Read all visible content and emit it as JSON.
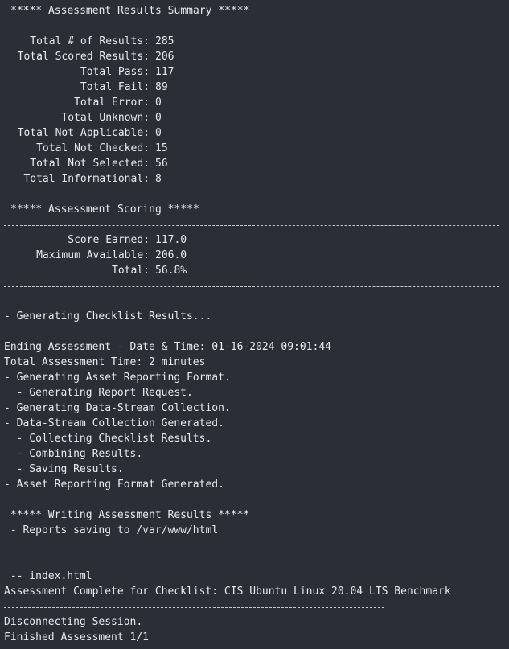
{
  "header": {
    "title": "***** Assessment Results Summary *****"
  },
  "results": [
    {
      "key": "Total # of Results:",
      "value": "285"
    },
    {
      "key": "Total Scored Results:",
      "value": "206"
    },
    {
      "key": "Total Pass:",
      "value": "117"
    },
    {
      "key": "Total Fail:",
      "value": "89"
    },
    {
      "key": "Total Error:",
      "value": "0"
    },
    {
      "key": "Total Unknown:",
      "value": "0"
    },
    {
      "key": "Total Not Applicable:",
      "value": "0"
    },
    {
      "key": "Total Not Checked:",
      "value": "15"
    },
    {
      "key": "Total Not Selected:",
      "value": "56"
    },
    {
      "key": "Total Informational:",
      "value": "8"
    }
  ],
  "scoring": {
    "title": "***** Assessment Scoring *****",
    "rows": [
      {
        "key": "Score Earned:",
        "value": "117.0"
      },
      {
        "key": "Maximum Available:",
        "value": "206.0"
      },
      {
        "key": "Total:",
        "value": "56.8%"
      }
    ]
  },
  "log": {
    "generating_checklist": "- Generating Checklist Results...",
    "ending": "Ending Assessment - Date & Time: 01-16-2024 09:01:44",
    "total_time": "Total Assessment Time: 2 minutes",
    "gen_arf": "- Generating Asset Reporting Format.",
    "gen_report_request": "  - Generating Report Request.",
    "gen_ds": "- Generating Data-Stream Collection.",
    "ds_generated": "- Data-Stream Collection Generated.",
    "collecting": "  - Collecting Checklist Results.",
    "combining": "  - Combining Results.",
    "saving": "  - Saving Results.",
    "arf_generated": "- Asset Reporting Format Generated.",
    "writing_title": " ***** Writing Assessment Results *****",
    "reports_saving": " - Reports saving to /var/www/html",
    "index_file": " -- index.html",
    "complete": "Assessment Complete for Checklist: CIS Ubuntu Linux 20.04 LTS Benchmark",
    "disconnecting": "Disconnecting Session.",
    "finished": "Finished Assessment 1/1"
  }
}
